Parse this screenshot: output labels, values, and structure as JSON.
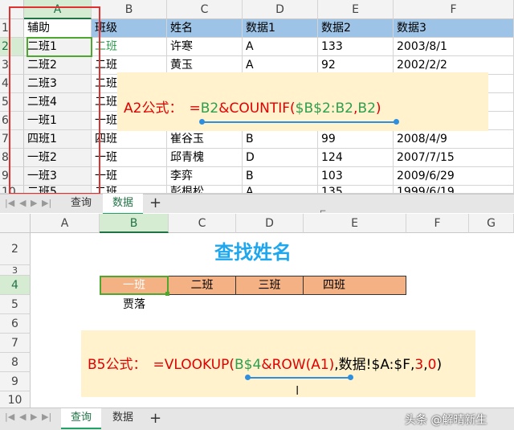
{
  "top_sheet": {
    "columns": [
      "A",
      "B",
      "C",
      "D",
      "E",
      "F"
    ],
    "rows": [
      "1",
      "2",
      "3",
      "4",
      "5",
      "6",
      "7",
      "8",
      "9",
      "10"
    ],
    "header_row": [
      "辅助",
      "班级",
      "姓名",
      "数据1",
      "数据2",
      "数据3"
    ],
    "data_rows": [
      [
        "二班1",
        "二班",
        "许寒",
        "A",
        "133",
        "2003/8/1"
      ],
      [
        "二班2",
        "二班",
        "黄玉",
        "A",
        "92",
        "2002/2/2"
      ],
      [
        "二班3",
        "二班",
        "",
        "",
        "",
        ""
      ],
      [
        "二班4",
        "二班",
        "",
        "",
        "",
        ""
      ],
      [
        "一班1",
        "一班",
        "",
        "",
        "",
        ""
      ],
      [
        "四班1",
        "四班",
        "崔谷玉",
        "B",
        "99",
        "2008/4/9"
      ],
      [
        "一班2",
        "一班",
        "邱青槐",
        "D",
        "124",
        "2007/7/15"
      ],
      [
        "一班3",
        "一班",
        "李弈",
        "B",
        "103",
        "2009/6/29"
      ],
      [
        "二班5",
        "二班",
        "彭根松",
        "A",
        "135",
        "1999/6/19"
      ]
    ],
    "tabs": [
      "查询",
      "数据"
    ],
    "add_tab": "+",
    "formula_label": "A2公式：",
    "formula_parts": [
      "=",
      "B2",
      "&COUNTIF(",
      "$B$2:B2",
      ",",
      "B2",
      ")"
    ]
  },
  "bottom_sheet": {
    "columns": [
      "A",
      "B",
      "C",
      "D",
      "E",
      "F",
      "G"
    ],
    "rows": [
      "2",
      "3",
      "4",
      "5",
      "6",
      "7",
      "8",
      "9",
      "10"
    ],
    "title": "查找姓名",
    "classes": [
      "一班",
      "二班",
      "三班",
      "四班"
    ],
    "b5_value": "贾落",
    "tabs": [
      "查询",
      "数据"
    ],
    "add_tab": "+",
    "formula_label": "B5公式：",
    "formula_parts": [
      "=VLOOKUP(",
      "B$4",
      "&ROW(A1)",
      ",数据!$A:$F,",
      "3",
      ",",
      "0",
      ")"
    ]
  },
  "watermark": "头条 @解晴新生",
  "colors": {
    "header_fill": "#9dc3e6",
    "accent_green": "#217346",
    "class_fill": "#f4b183",
    "title_blue": "#1ea7ee",
    "formula_red": "#e00000",
    "formula_green": "#2e9e4f",
    "callout_bg": "#fff2cc",
    "red_box": "#e03030"
  }
}
